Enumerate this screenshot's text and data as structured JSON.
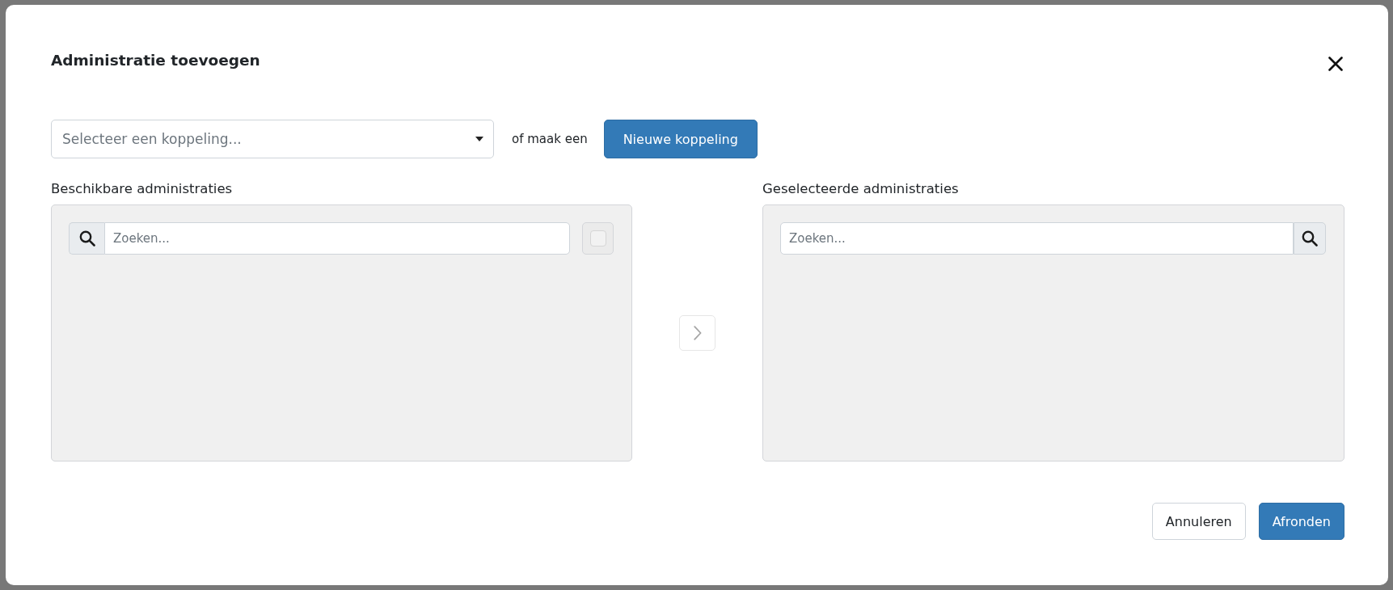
{
  "dialog": {
    "title": "Administratie toevoegen"
  },
  "link_row": {
    "select": {
      "placeholder": "Selecteer een koppeling..."
    },
    "or_text": "of maak een",
    "new_button": {
      "label": "Nieuwe koppeling"
    }
  },
  "available": {
    "label": "Beschikbare administraties",
    "search": {
      "placeholder": "Zoeken..."
    },
    "select_all": {
      "checked": false,
      "disabled": true
    }
  },
  "move_button": {
    "disabled": true
  },
  "chosen": {
    "label": "Geselecteerde administraties",
    "search": {
      "placeholder": "Zoeken..."
    }
  },
  "footer": {
    "buttons": [
      {
        "label": "Annuleren",
        "kind": "secondary"
      },
      {
        "label": "Afronden",
        "kind": "primary"
      }
    ]
  }
}
